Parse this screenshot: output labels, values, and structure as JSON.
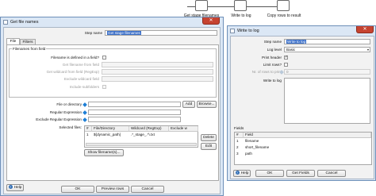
{
  "workflow": {
    "nodes": [
      "Get stage filenames",
      "Write to log",
      "Copy rows to result"
    ]
  },
  "dialog1": {
    "title": "Get file names",
    "step_name_label": "Step name",
    "step_name_value": "Get stage filenames",
    "tabs": [
      "File",
      "Filters"
    ],
    "group_label": "Filenames from field",
    "defined_in_field_label": "Filename is defined in a field?",
    "from_field_label": "Get filename from field",
    "wildcard_from_field_label": "Get wildcard from field (RegExp)",
    "exclude_wildcard_field_label": "Exclude wildcard field",
    "include_subfolders_label": "Include subfolders",
    "file_or_dir_label": "File or directory",
    "regex_label": "Regular Expression",
    "exclude_regex_label": "Exclude Regular Expression",
    "selected_files_label": "Selected files:",
    "add_label": "Add",
    "browse_label": "Browse...",
    "delete_label": "Delete",
    "edit_label": "Edit",
    "table_headers": [
      "#",
      "File/Directory",
      "Wildcard (RegExp)",
      "Exclude w"
    ],
    "table_rows": [
      {
        "num": "1",
        "file": "${dynamic_path}",
        "wildcard": ".*_stage_.*\\.txt",
        "exclude": ""
      }
    ],
    "show_filenames_label": "Show filename(s)...",
    "help_label": "Help",
    "ok_label": "OK",
    "preview_label": "Preview rows",
    "cancel_label": "Cancel"
  },
  "dialog2": {
    "title": "Write to log",
    "step_name_label": "Step name",
    "step_name_value": "Write to log",
    "log_level_label": "Log level",
    "log_level_value": "Basic",
    "print_header_label": "Print header",
    "limit_rows_label": "Limit rows?",
    "nr_rows_label": "Nr. of rows to print",
    "nr_rows_value": "0",
    "write_to_log_label": "Write to log",
    "fields_label": "Fields",
    "fields_headers": [
      "#",
      "Field"
    ],
    "fields_rows": [
      {
        "num": "1",
        "field": "filename"
      },
      {
        "num": "2",
        "field": "short_filename"
      },
      {
        "num": "3",
        "field": "path"
      }
    ],
    "help_label": "Help",
    "ok_label": "OK",
    "get_fields_label": "Get Fields",
    "cancel_label": "Cancel"
  }
}
